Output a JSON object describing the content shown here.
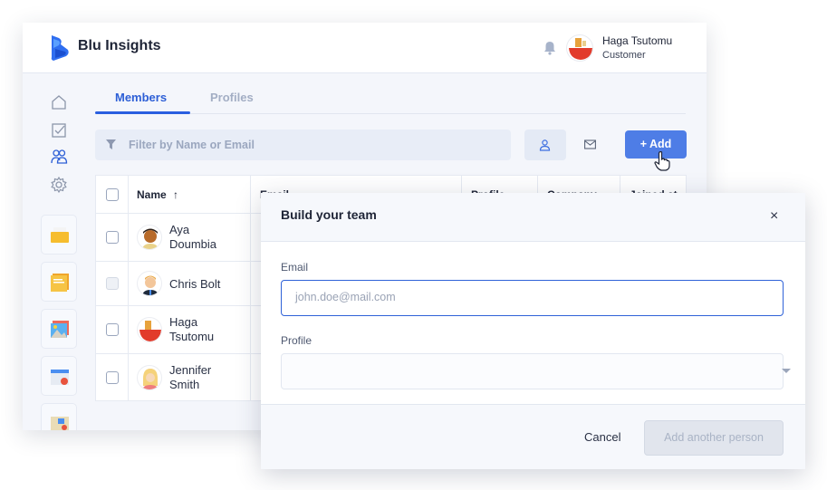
{
  "app": {
    "brand": "Blu Insights",
    "user": {
      "name": "Haga Tsutomu",
      "role": "Customer"
    }
  },
  "sidebar": {
    "nav": [
      {
        "icon": "home-icon",
        "active": false
      },
      {
        "icon": "checkbox-icon",
        "active": false
      },
      {
        "icon": "users-icon",
        "active": true
      },
      {
        "icon": "gear-icon",
        "active": false
      }
    ],
    "apps": [
      "folder-app",
      "notes-app",
      "gallery-app",
      "calendar-app",
      "board-app"
    ]
  },
  "tabs": [
    {
      "label": "Members",
      "active": true
    },
    {
      "label": "Profiles",
      "active": false
    }
  ],
  "toolbar": {
    "filter_placeholder": "Filter by Name or Email",
    "add_label": "+ Add"
  },
  "table": {
    "columns": [
      "Name",
      "Email",
      "Profile",
      "Company",
      "Joined at"
    ],
    "sort": {
      "column": "Name",
      "direction": "asc",
      "indicator": "↑"
    },
    "rows": [
      {
        "name": "Aya Doumbia",
        "checkbox_enabled": true
      },
      {
        "name": "Chris Bolt",
        "checkbox_enabled": false
      },
      {
        "name": "Haga Tsutomu",
        "checkbox_enabled": true
      },
      {
        "name": "Jennifer Smith",
        "checkbox_enabled": true
      }
    ]
  },
  "modal": {
    "title": "Build your team",
    "close": "×",
    "email_label": "Email",
    "email_placeholder": "john.doe@mail.com",
    "email_value": "",
    "profile_label": "Profile",
    "profile_value": "",
    "cancel_label": "Cancel",
    "submit_label": "Add another person",
    "submit_enabled": false
  },
  "colors": {
    "accent": "#2a5fe0",
    "add_button": "#4e7de6",
    "background": "#f4f6fb"
  }
}
